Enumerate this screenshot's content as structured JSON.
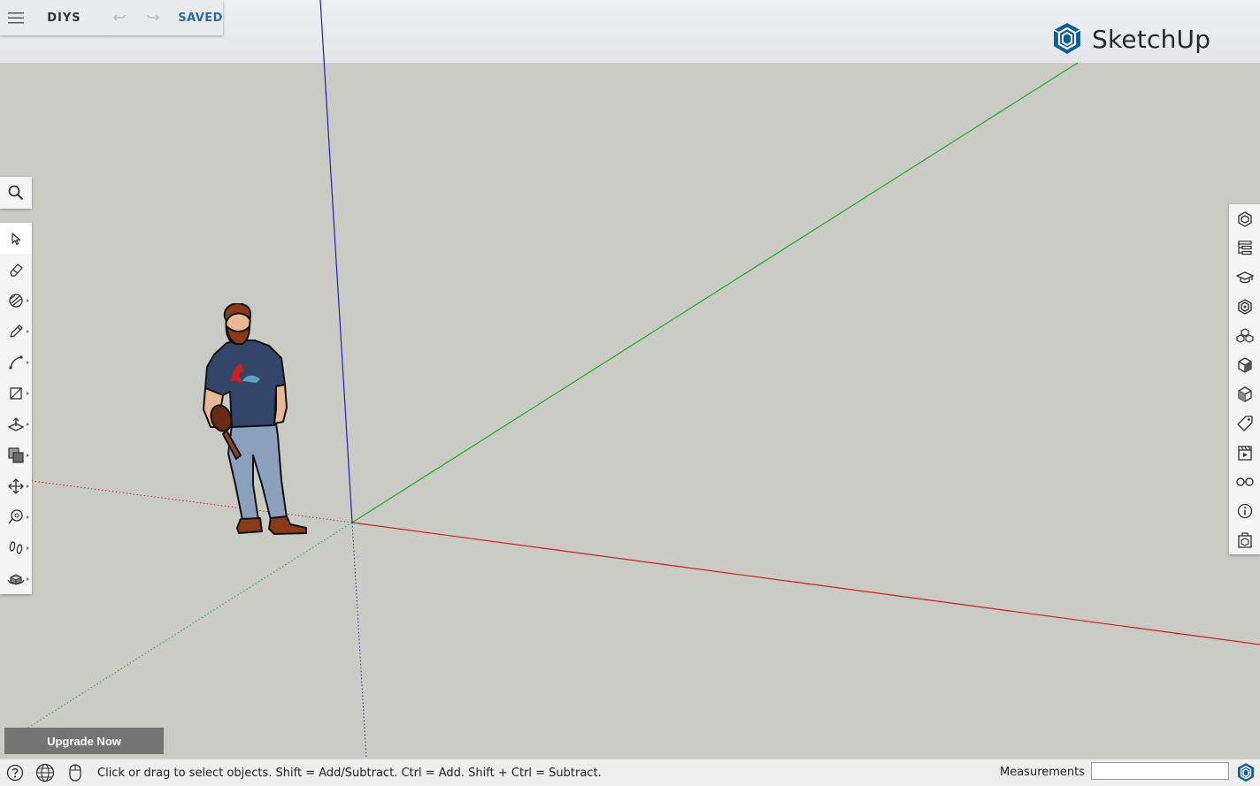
{
  "app": {
    "name": "SketchUp",
    "project_name": "DIYS",
    "save_status": "SAVED"
  },
  "colors": {
    "accent": "#2b6aa8",
    "axis_red": "#c82020",
    "axis_green": "#1faa1f",
    "axis_blue": "#2020b8",
    "logo": "#0d5d9a"
  },
  "topbar": {
    "menu_icon": "hamburger-menu-icon",
    "undo_icon": "undo-icon",
    "redo_icon": "redo-icon"
  },
  "left_toolbar": {
    "search_icon": "search-icon",
    "tools": [
      {
        "name": "select-tool",
        "icon": "arrow-cursor-icon",
        "active": true,
        "flyout": false
      },
      {
        "name": "eraser-tool",
        "icon": "eraser-icon",
        "active": false,
        "flyout": false
      },
      {
        "name": "paint-bucket-tool",
        "icon": "paint-icon",
        "active": false,
        "flyout": true
      },
      {
        "name": "line-tool",
        "icon": "pencil-icon",
        "active": false,
        "flyout": true
      },
      {
        "name": "arc-tool",
        "icon": "arc-icon",
        "active": false,
        "flyout": true
      },
      {
        "name": "rectangle-tool",
        "icon": "rectangle-icon",
        "active": false,
        "flyout": true
      },
      {
        "name": "push-pull-tool",
        "icon": "push-pull-icon",
        "active": false,
        "flyout": true
      },
      {
        "name": "offset-tool",
        "icon": "offset-icon",
        "active": false,
        "flyout": true
      },
      {
        "name": "move-tool",
        "icon": "move-icon",
        "active": false,
        "flyout": true
      },
      {
        "name": "tape-measure-tool",
        "icon": "tape-measure-icon",
        "active": false,
        "flyout": true
      },
      {
        "name": "walk-tool",
        "icon": "footprints-icon",
        "active": false,
        "flyout": true
      },
      {
        "name": "orbit-tool",
        "icon": "orbit-icon",
        "active": false,
        "flyout": true
      }
    ]
  },
  "right_panels": [
    {
      "name": "entity-info-panel",
      "icon": "cube-outline-icon"
    },
    {
      "name": "outliner-panel",
      "icon": "outliner-icon"
    },
    {
      "name": "instructor-panel",
      "icon": "graduation-cap-icon"
    },
    {
      "name": "materials-panel",
      "icon": "materials-icon"
    },
    {
      "name": "components-panel",
      "icon": "components-icon"
    },
    {
      "name": "styles-panel",
      "icon": "styles-cube-icon"
    },
    {
      "name": "shadows-panel",
      "icon": "shadow-cube-icon"
    },
    {
      "name": "tags-panel",
      "icon": "tag-icon"
    },
    {
      "name": "scenes-panel",
      "icon": "scenes-clapper-icon"
    },
    {
      "name": "display-panel",
      "icon": "glasses-icon"
    },
    {
      "name": "info-panel",
      "icon": "info-icon"
    },
    {
      "name": "extension-panel",
      "icon": "extension-box-icon"
    }
  ],
  "upgrade": {
    "label": "Upgrade Now"
  },
  "statusbar": {
    "help_icon": "help-icon",
    "globe_icon": "globe-icon",
    "mouse_icon": "mouse-icon",
    "hint": "Click or drag to select objects. Shift = Add/Subtract. Ctrl = Add. Shift + Ctrl = Subtract.",
    "measurements_label": "Measurements",
    "measurements_value": ""
  }
}
